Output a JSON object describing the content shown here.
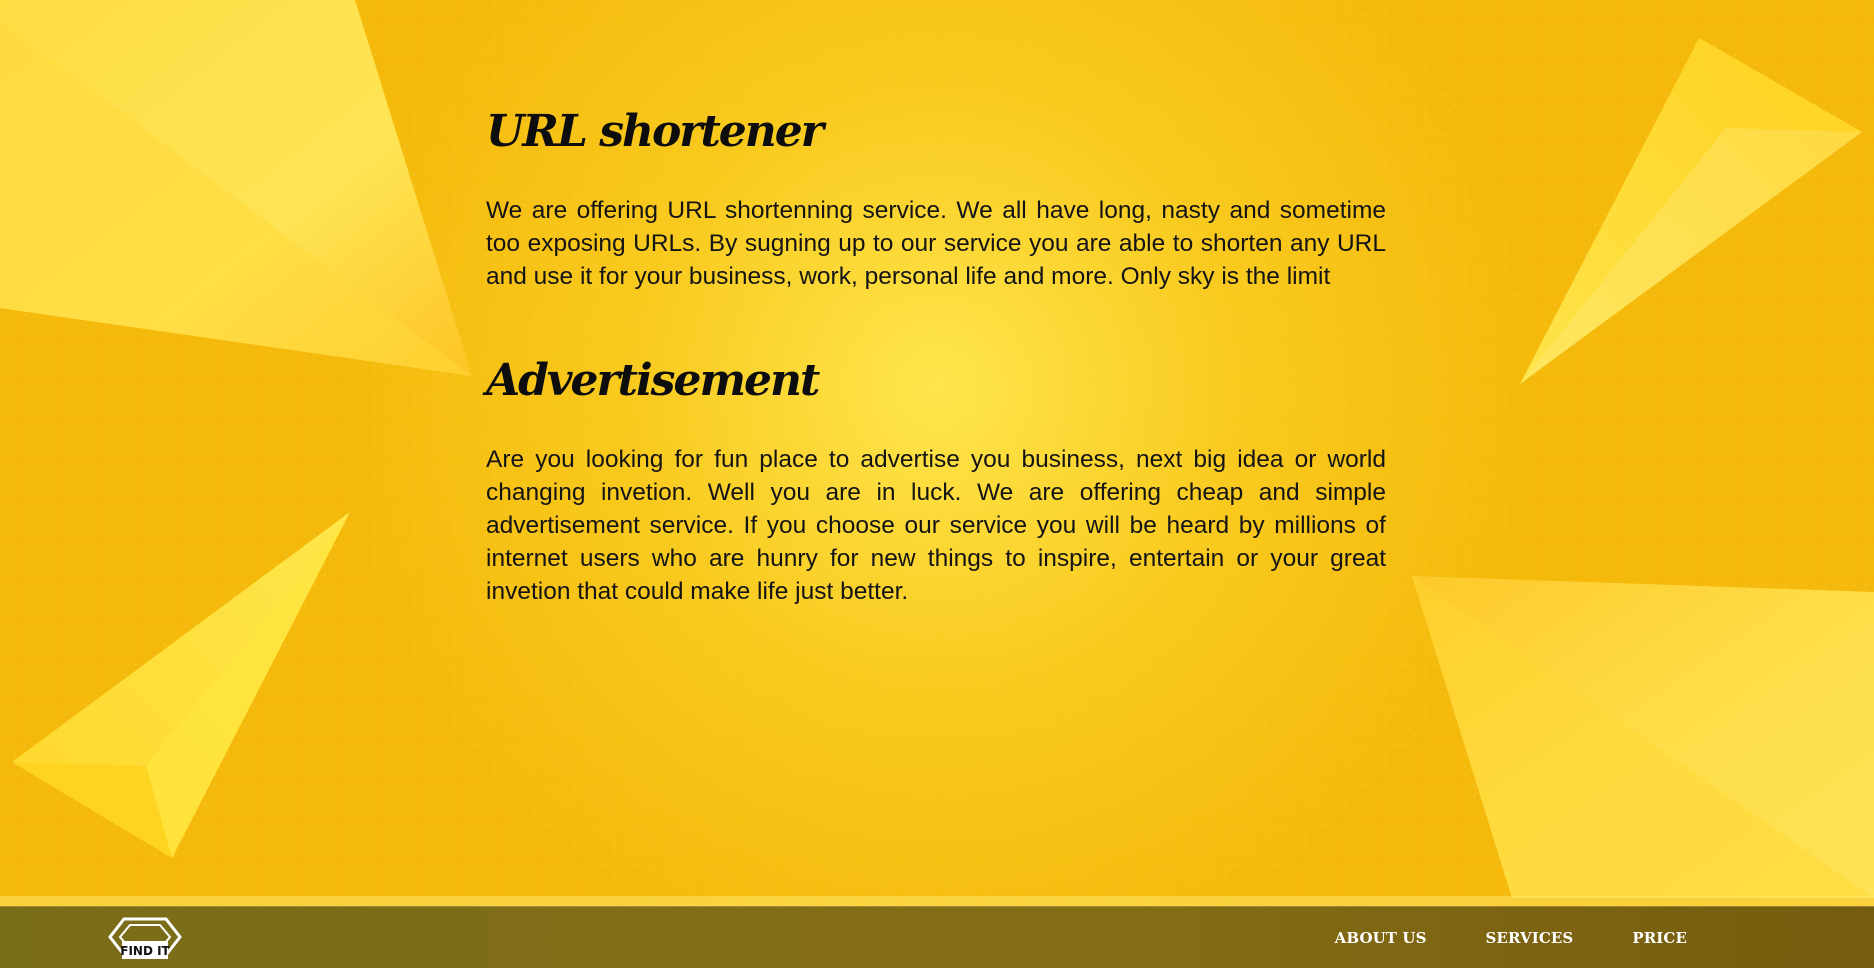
{
  "sections": [
    {
      "title": "URL shortener",
      "text": "We are offering URL shortenning service. We all have long, nasty and sometime too exposing URLs. By sugning up to our service you are able to shorten any URL and use it for your business, work, personal life and more. Only sky is the limit"
    },
    {
      "title": "Advertisement",
      "text": "Are you looking for fun place to advertise you business, next big idea or world changing invetion. Well you are in luck. We are offering cheap and simple advertisement service. If you choose our service you will be heard by millions of internet users who are hunry for new things to inspire, entertain or your great invetion that could make life just better."
    }
  ],
  "footer": {
    "logo_text": "FIND IT",
    "logo_icon": "hexagon-logo-icon",
    "nav": [
      "ABOUT US",
      "SERVICES",
      "PRICE"
    ]
  },
  "colors": {
    "background": "#f4b90a",
    "highlight": "#ffe850",
    "footer_bar": "#766619",
    "nav_text": "#ffffff",
    "heading_text": "#0d0d0d"
  }
}
